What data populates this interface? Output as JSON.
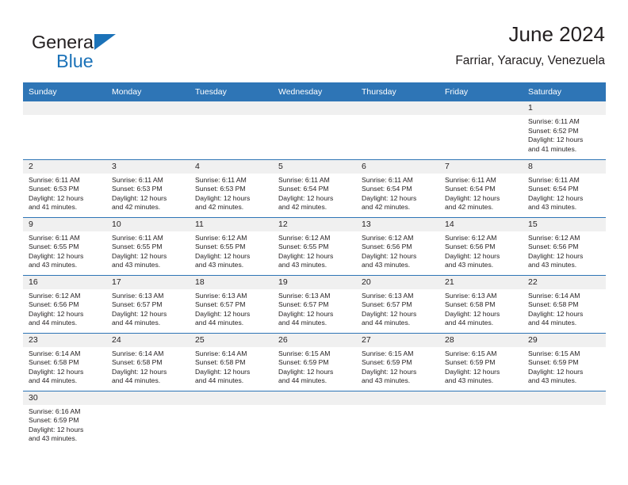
{
  "logo": {
    "word1": "General",
    "word2": "Blue",
    "triangle_color": "#1b72b8",
    "text_color": "#231f20"
  },
  "header": {
    "title": "June 2024",
    "location": "Farriar, Yaracuy, Venezuela"
  },
  "theme": {
    "header_bg": "#2e75b6",
    "header_text": "#ffffff",
    "daynum_bg": "#f0f0f0",
    "row_border": "#2e75b6",
    "body_text": "#231f20"
  },
  "calendar": {
    "weekdays": [
      "Sunday",
      "Monday",
      "Tuesday",
      "Wednesday",
      "Thursday",
      "Friday",
      "Saturday"
    ],
    "weeks": [
      [
        {
          "day": "",
          "sunrise": "",
          "sunset": "",
          "daylight1": "",
          "daylight2": ""
        },
        {
          "day": "",
          "sunrise": "",
          "sunset": "",
          "daylight1": "",
          "daylight2": ""
        },
        {
          "day": "",
          "sunrise": "",
          "sunset": "",
          "daylight1": "",
          "daylight2": ""
        },
        {
          "day": "",
          "sunrise": "",
          "sunset": "",
          "daylight1": "",
          "daylight2": ""
        },
        {
          "day": "",
          "sunrise": "",
          "sunset": "",
          "daylight1": "",
          "daylight2": ""
        },
        {
          "day": "",
          "sunrise": "",
          "sunset": "",
          "daylight1": "",
          "daylight2": ""
        },
        {
          "day": "1",
          "sunrise": "Sunrise: 6:11 AM",
          "sunset": "Sunset: 6:52 PM",
          "daylight1": "Daylight: 12 hours",
          "daylight2": "and 41 minutes."
        }
      ],
      [
        {
          "day": "2",
          "sunrise": "Sunrise: 6:11 AM",
          "sunset": "Sunset: 6:53 PM",
          "daylight1": "Daylight: 12 hours",
          "daylight2": "and 41 minutes."
        },
        {
          "day": "3",
          "sunrise": "Sunrise: 6:11 AM",
          "sunset": "Sunset: 6:53 PM",
          "daylight1": "Daylight: 12 hours",
          "daylight2": "and 42 minutes."
        },
        {
          "day": "4",
          "sunrise": "Sunrise: 6:11 AM",
          "sunset": "Sunset: 6:53 PM",
          "daylight1": "Daylight: 12 hours",
          "daylight2": "and 42 minutes."
        },
        {
          "day": "5",
          "sunrise": "Sunrise: 6:11 AM",
          "sunset": "Sunset: 6:54 PM",
          "daylight1": "Daylight: 12 hours",
          "daylight2": "and 42 minutes."
        },
        {
          "day": "6",
          "sunrise": "Sunrise: 6:11 AM",
          "sunset": "Sunset: 6:54 PM",
          "daylight1": "Daylight: 12 hours",
          "daylight2": "and 42 minutes."
        },
        {
          "day": "7",
          "sunrise": "Sunrise: 6:11 AM",
          "sunset": "Sunset: 6:54 PM",
          "daylight1": "Daylight: 12 hours",
          "daylight2": "and 42 minutes."
        },
        {
          "day": "8",
          "sunrise": "Sunrise: 6:11 AM",
          "sunset": "Sunset: 6:54 PM",
          "daylight1": "Daylight: 12 hours",
          "daylight2": "and 43 minutes."
        }
      ],
      [
        {
          "day": "9",
          "sunrise": "Sunrise: 6:11 AM",
          "sunset": "Sunset: 6:55 PM",
          "daylight1": "Daylight: 12 hours",
          "daylight2": "and 43 minutes."
        },
        {
          "day": "10",
          "sunrise": "Sunrise: 6:11 AM",
          "sunset": "Sunset: 6:55 PM",
          "daylight1": "Daylight: 12 hours",
          "daylight2": "and 43 minutes."
        },
        {
          "day": "11",
          "sunrise": "Sunrise: 6:12 AM",
          "sunset": "Sunset: 6:55 PM",
          "daylight1": "Daylight: 12 hours",
          "daylight2": "and 43 minutes."
        },
        {
          "day": "12",
          "sunrise": "Sunrise: 6:12 AM",
          "sunset": "Sunset: 6:55 PM",
          "daylight1": "Daylight: 12 hours",
          "daylight2": "and 43 minutes."
        },
        {
          "day": "13",
          "sunrise": "Sunrise: 6:12 AM",
          "sunset": "Sunset: 6:56 PM",
          "daylight1": "Daylight: 12 hours",
          "daylight2": "and 43 minutes."
        },
        {
          "day": "14",
          "sunrise": "Sunrise: 6:12 AM",
          "sunset": "Sunset: 6:56 PM",
          "daylight1": "Daylight: 12 hours",
          "daylight2": "and 43 minutes."
        },
        {
          "day": "15",
          "sunrise": "Sunrise: 6:12 AM",
          "sunset": "Sunset: 6:56 PM",
          "daylight1": "Daylight: 12 hours",
          "daylight2": "and 43 minutes."
        }
      ],
      [
        {
          "day": "16",
          "sunrise": "Sunrise: 6:12 AM",
          "sunset": "Sunset: 6:56 PM",
          "daylight1": "Daylight: 12 hours",
          "daylight2": "and 44 minutes."
        },
        {
          "day": "17",
          "sunrise": "Sunrise: 6:13 AM",
          "sunset": "Sunset: 6:57 PM",
          "daylight1": "Daylight: 12 hours",
          "daylight2": "and 44 minutes."
        },
        {
          "day": "18",
          "sunrise": "Sunrise: 6:13 AM",
          "sunset": "Sunset: 6:57 PM",
          "daylight1": "Daylight: 12 hours",
          "daylight2": "and 44 minutes."
        },
        {
          "day": "19",
          "sunrise": "Sunrise: 6:13 AM",
          "sunset": "Sunset: 6:57 PM",
          "daylight1": "Daylight: 12 hours",
          "daylight2": "and 44 minutes."
        },
        {
          "day": "20",
          "sunrise": "Sunrise: 6:13 AM",
          "sunset": "Sunset: 6:57 PM",
          "daylight1": "Daylight: 12 hours",
          "daylight2": "and 44 minutes."
        },
        {
          "day": "21",
          "sunrise": "Sunrise: 6:13 AM",
          "sunset": "Sunset: 6:58 PM",
          "daylight1": "Daylight: 12 hours",
          "daylight2": "and 44 minutes."
        },
        {
          "day": "22",
          "sunrise": "Sunrise: 6:14 AM",
          "sunset": "Sunset: 6:58 PM",
          "daylight1": "Daylight: 12 hours",
          "daylight2": "and 44 minutes."
        }
      ],
      [
        {
          "day": "23",
          "sunrise": "Sunrise: 6:14 AM",
          "sunset": "Sunset: 6:58 PM",
          "daylight1": "Daylight: 12 hours",
          "daylight2": "and 44 minutes."
        },
        {
          "day": "24",
          "sunrise": "Sunrise: 6:14 AM",
          "sunset": "Sunset: 6:58 PM",
          "daylight1": "Daylight: 12 hours",
          "daylight2": "and 44 minutes."
        },
        {
          "day": "25",
          "sunrise": "Sunrise: 6:14 AM",
          "sunset": "Sunset: 6:58 PM",
          "daylight1": "Daylight: 12 hours",
          "daylight2": "and 44 minutes."
        },
        {
          "day": "26",
          "sunrise": "Sunrise: 6:15 AM",
          "sunset": "Sunset: 6:59 PM",
          "daylight1": "Daylight: 12 hours",
          "daylight2": "and 44 minutes."
        },
        {
          "day": "27",
          "sunrise": "Sunrise: 6:15 AM",
          "sunset": "Sunset: 6:59 PM",
          "daylight1": "Daylight: 12 hours",
          "daylight2": "and 43 minutes."
        },
        {
          "day": "28",
          "sunrise": "Sunrise: 6:15 AM",
          "sunset": "Sunset: 6:59 PM",
          "daylight1": "Daylight: 12 hours",
          "daylight2": "and 43 minutes."
        },
        {
          "day": "29",
          "sunrise": "Sunrise: 6:15 AM",
          "sunset": "Sunset: 6:59 PM",
          "daylight1": "Daylight: 12 hours",
          "daylight2": "and 43 minutes."
        }
      ],
      [
        {
          "day": "30",
          "sunrise": "Sunrise: 6:16 AM",
          "sunset": "Sunset: 6:59 PM",
          "daylight1": "Daylight: 12 hours",
          "daylight2": "and 43 minutes."
        },
        {
          "day": "",
          "sunrise": "",
          "sunset": "",
          "daylight1": "",
          "daylight2": ""
        },
        {
          "day": "",
          "sunrise": "",
          "sunset": "",
          "daylight1": "",
          "daylight2": ""
        },
        {
          "day": "",
          "sunrise": "",
          "sunset": "",
          "daylight1": "",
          "daylight2": ""
        },
        {
          "day": "",
          "sunrise": "",
          "sunset": "",
          "daylight1": "",
          "daylight2": ""
        },
        {
          "day": "",
          "sunrise": "",
          "sunset": "",
          "daylight1": "",
          "daylight2": ""
        },
        {
          "day": "",
          "sunrise": "",
          "sunset": "",
          "daylight1": "",
          "daylight2": ""
        }
      ]
    ]
  }
}
